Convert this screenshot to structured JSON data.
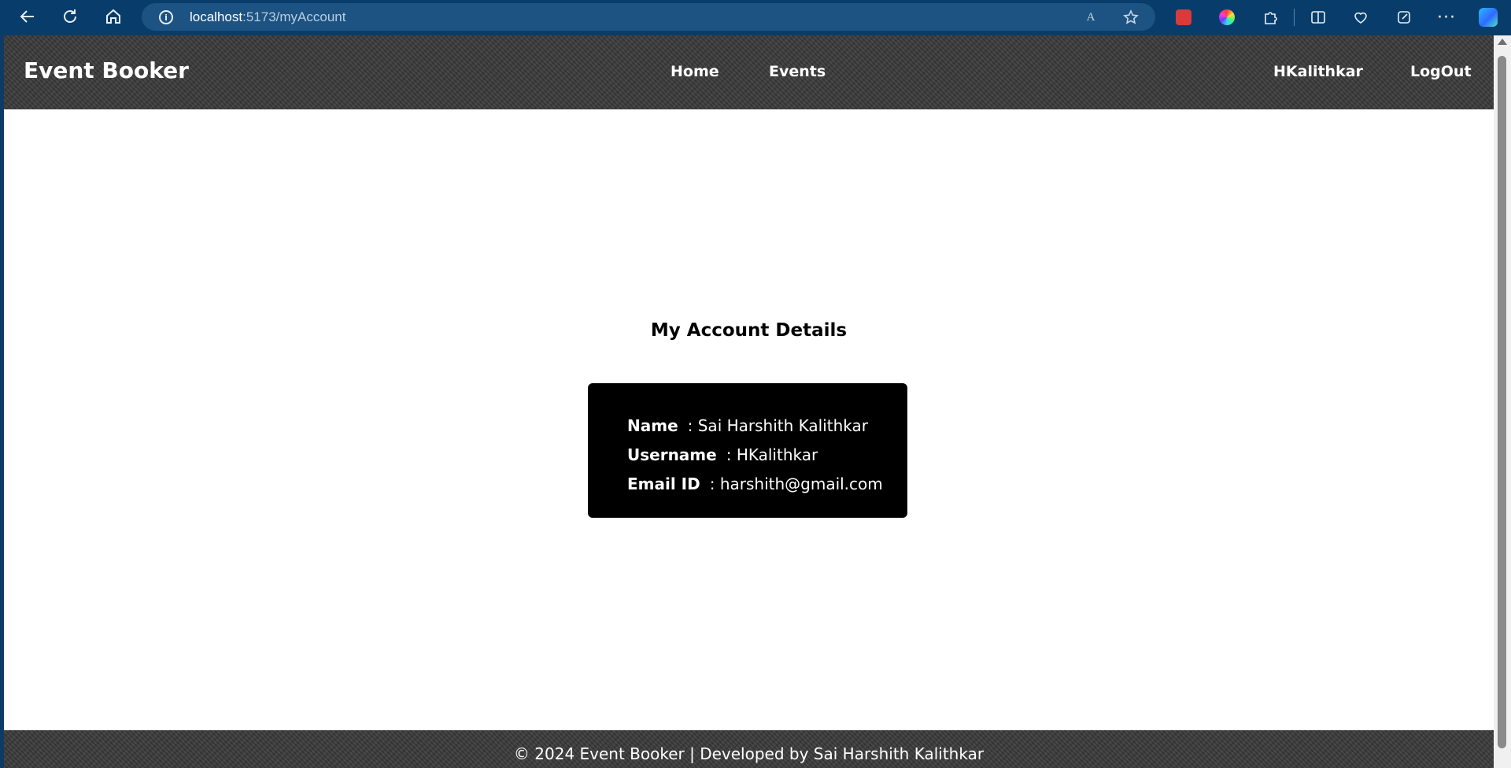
{
  "browser": {
    "url_host": "localhost",
    "url_rest": ":5173/myAccount",
    "icons": {
      "back": "back-arrow-icon",
      "refresh": "refresh-icon",
      "home": "home-icon",
      "info": "info-icon",
      "read_aloud": "read-aloud-icon",
      "favorite": "star-icon",
      "more": "more-icon"
    },
    "read_aloud_glyph": "A",
    "info_glyph": "i",
    "more_glyph": "···"
  },
  "navbar": {
    "brand": "Event Booker",
    "links": {
      "home": "Home",
      "events": "Events",
      "user": "HKalithkar",
      "logout": "LogOut"
    }
  },
  "main": {
    "heading": "My Account Details",
    "details": [
      {
        "label": "Name",
        "value": ": Sai Harshith Kalithkar"
      },
      {
        "label": "Username",
        "value": ": HKalithkar"
      },
      {
        "label": "Email ID",
        "value": ": harshith@gmail.com"
      }
    ]
  },
  "footer": {
    "text": "© 2024 Event Booker | Developed by Sai Harshith Kalithkar"
  },
  "colors": {
    "browser_bar": "#083d6b",
    "navbar": "#3a3a3a",
    "card": "#000000"
  }
}
